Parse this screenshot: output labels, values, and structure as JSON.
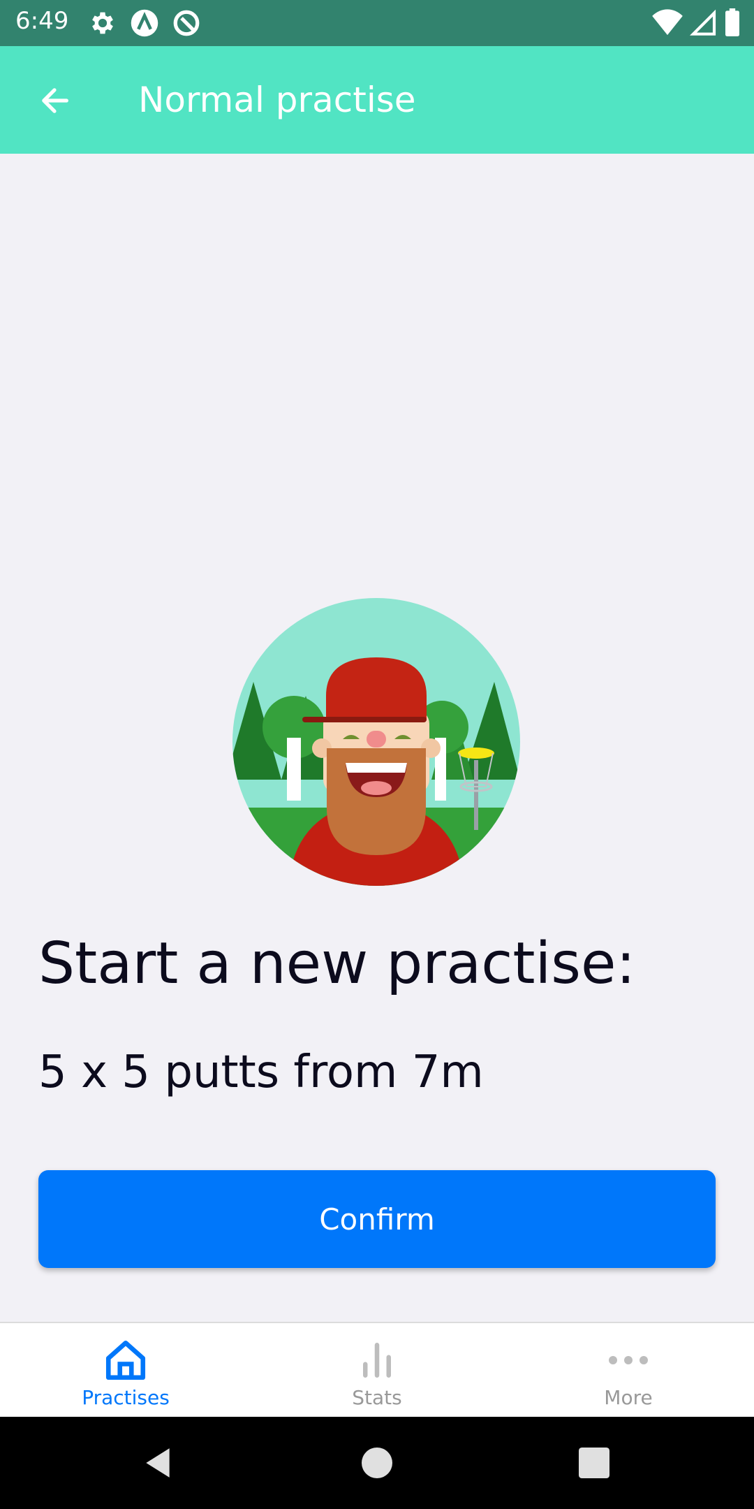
{
  "status_bar": {
    "time": "6:49",
    "left_icons": [
      "settings-icon",
      "app-a-icon",
      "app-q-icon"
    ],
    "right_icons": [
      "wifi-icon",
      "signal-icon",
      "battery-icon"
    ]
  },
  "app_bar": {
    "title": "Normal practise",
    "background": "#51e4c3"
  },
  "main": {
    "heading": "Start a new practise:",
    "subheading": "5 x 5 putts from 7m",
    "confirm_label": "Confirm"
  },
  "bottom_nav": {
    "items": [
      {
        "label": "Practises",
        "icon": "home-icon",
        "active": true
      },
      {
        "label": "Stats",
        "icon": "bar-chart-icon",
        "active": false
      },
      {
        "label": "More",
        "icon": "more-dots-icon",
        "active": false
      }
    ],
    "active_color": "#0077fa",
    "inactive_color": "#999999"
  },
  "colors": {
    "status_bar": "#32836e",
    "background": "#f2f1f6",
    "primary_button": "#0077fa"
  }
}
